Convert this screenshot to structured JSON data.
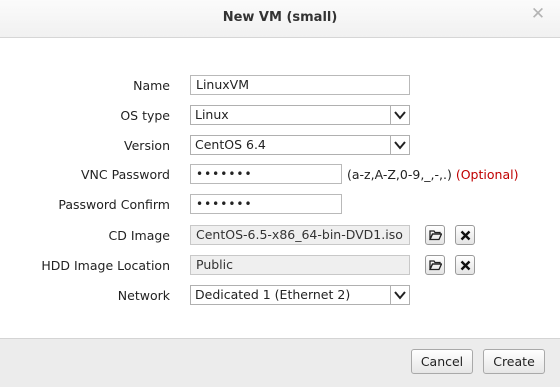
{
  "dialog": {
    "title": "New VM (small)"
  },
  "fields": {
    "name": {
      "label": "Name",
      "value": "LinuxVM"
    },
    "os_type": {
      "label": "OS type",
      "value": "Linux"
    },
    "version": {
      "label": "Version",
      "value": "CentOS 6.4"
    },
    "vnc_password": {
      "label": "VNC Password",
      "value": "•••••••",
      "hint": "(a-z,A-Z,0-9,_,-,.)",
      "optional": "(Optional)"
    },
    "password_confirm": {
      "label": "Password Confirm",
      "value": "•••••••"
    },
    "cd_image": {
      "label": "CD Image",
      "value": "CentOS-6.5-x86_64-bin-DVD1.iso"
    },
    "hdd_location": {
      "label": "HDD Image Location",
      "value": "Public"
    },
    "network": {
      "label": "Network",
      "value": "Dedicated 1 (Ethernet 2)"
    }
  },
  "footer": {
    "cancel_label": "Cancel",
    "create_label": "Create"
  },
  "icons": {
    "close": "close-icon",
    "dropdown": "chevron-down-icon",
    "browse": "folder-open-icon",
    "clear": "x-icon"
  }
}
